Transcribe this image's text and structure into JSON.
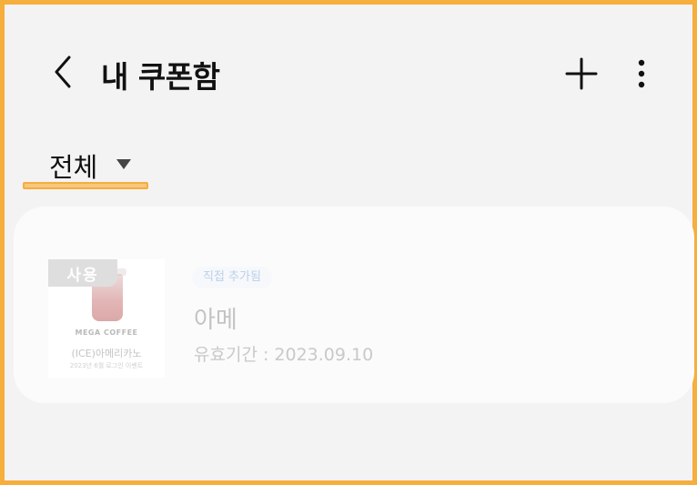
{
  "header": {
    "title": "내 쿠폰함",
    "back_icon": "chevron-left-icon",
    "add_icon": "plus-icon",
    "more_icon": "more-vertical-icon"
  },
  "filter": {
    "selected": "전체",
    "icon": "caret-down-icon"
  },
  "coupons": [
    {
      "status_badge": "사용",
      "tag": "직접 추가됨",
      "name": "아메",
      "expiry": "유효기간 : 2023.09.10",
      "thumbnail": {
        "brand": "MEGA COFFEE",
        "product": "(ICE)아메리카노",
        "subtitle": "2023년 6월 로그인 이벤트"
      }
    }
  ],
  "colors": {
    "accent": "#f6ae3d",
    "background": "#f3f3f3",
    "card": "#fbfbfb"
  }
}
